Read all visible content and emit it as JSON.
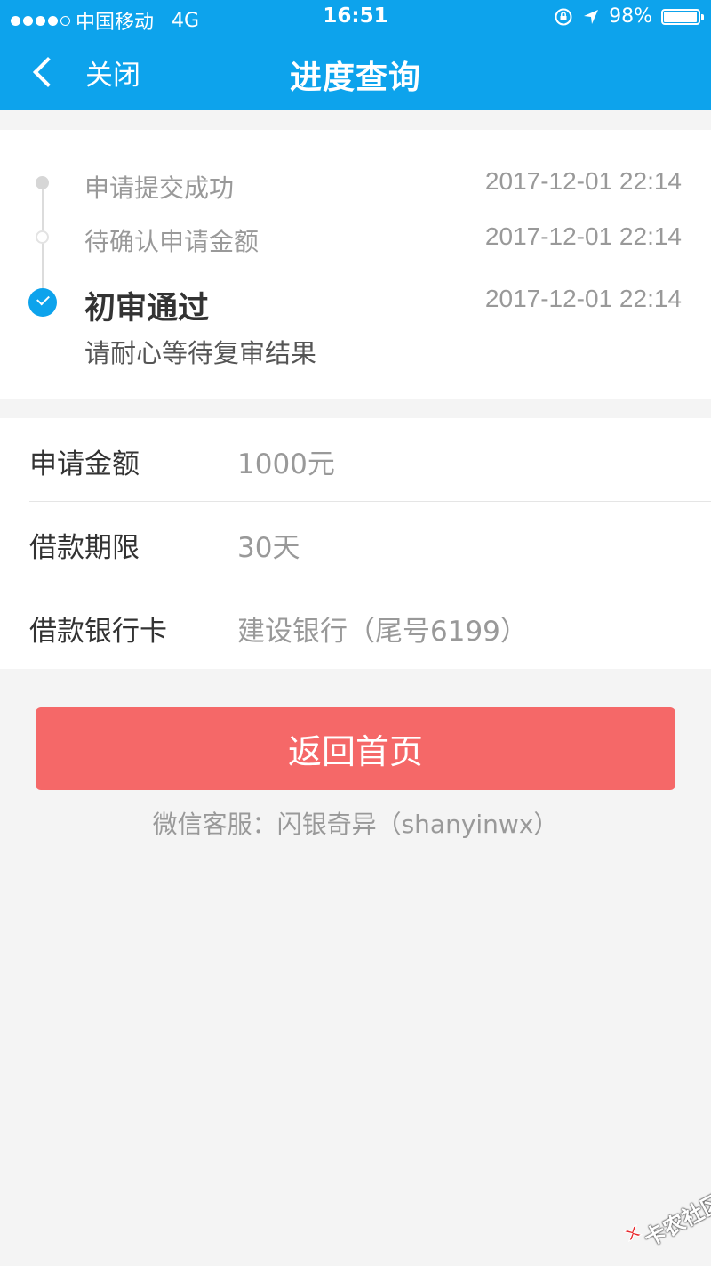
{
  "status_bar": {
    "carrier": "中国移动",
    "network": "4G",
    "time": "16:51",
    "battery": "98%",
    "battery_level": 0.98
  },
  "nav": {
    "back_label": "关闭",
    "title": "进度查询"
  },
  "timeline": {
    "steps": [
      {
        "label": "申请提交成功",
        "time": "2017-12-01 22:14",
        "state": "done"
      },
      {
        "label": "待确认申请金额",
        "time": "2017-12-01 22:14",
        "state": "pending"
      },
      {
        "label": "初审通过",
        "time": "2017-12-01 22:14",
        "state": "current",
        "subtitle": "请耐心等待复审结果"
      }
    ]
  },
  "details": {
    "rows": [
      {
        "label": "申请金额",
        "value": "1000元"
      },
      {
        "label": "借款期限",
        "value": "30天"
      },
      {
        "label": "借款银行卡",
        "value": "建设银行（尾号6199）"
      }
    ]
  },
  "actions": {
    "home_label": "返回首页"
  },
  "footer": {
    "service_text": "微信客服：闪银奇异（shanyinwx）"
  },
  "watermark": {
    "text": "卡农社区"
  },
  "colors": {
    "primary": "#0da3ec",
    "button": "#f56868",
    "muted_text": "#999999",
    "background": "#f4f4f4"
  }
}
